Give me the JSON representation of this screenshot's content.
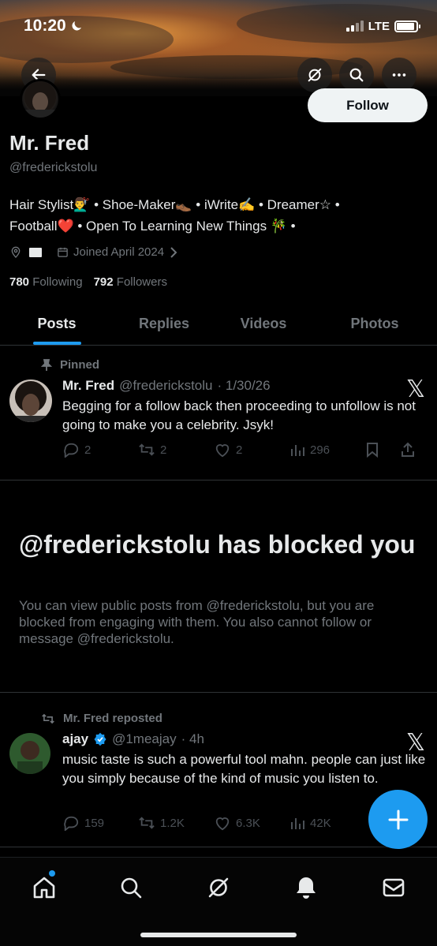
{
  "status_bar": {
    "time": "10:20",
    "network": "LTE"
  },
  "header": {
    "back_label": "Back",
    "follow_label": "Follow"
  },
  "profile": {
    "name": "Mr. Fred",
    "handle": "@frederickstolu",
    "bio_line1": "Hair Stylist💇‍♂️ • Shoe-Maker👞 • iWrite✍️ • Dreamer☆ •",
    "bio_line2": "Football❤️ • Open To Learning New Things 🎋 •",
    "joined": "Joined April 2024",
    "following_count": "780",
    "following_label": "Following",
    "followers_count": "792",
    "followers_label": "Followers"
  },
  "tabs": [
    {
      "label": "Posts",
      "active": true
    },
    {
      "label": "Replies",
      "active": false
    },
    {
      "label": "Videos",
      "active": false
    },
    {
      "label": "Photos",
      "active": false
    }
  ],
  "pinned_post": {
    "context": "Pinned",
    "name": "Mr. Fred",
    "handle": "@frederickstolu",
    "date": "· 1/30/26",
    "text": "Begging for a follow back then proceeding to unfollow is not going to make you a celebrity. Jsyk!",
    "replies": "2",
    "reposts": "2",
    "likes": "2",
    "views": "296"
  },
  "blocked": {
    "title": "@frederickstolu has blocked you",
    "body": "You can view public posts from @frederickstolu, but you are blocked from engaging with them. You also cannot follow or message @frederickstolu."
  },
  "repost": {
    "context": "Mr. Fred reposted",
    "name": "ajay",
    "handle": "@1meajay",
    "time": "· 4h",
    "text": "music taste is such a powerful tool mahn. people can just like you simply because of the kind of music you listen to.",
    "replies": "159",
    "reposts": "1.2K",
    "likes": "6.3K",
    "views": "42K"
  },
  "colors": {
    "accent": "#1d9bf0",
    "background": "#000000",
    "muted": "#71767b",
    "text": "#e7e9ea"
  },
  "icons": [
    "back-arrow-icon",
    "grok-icon",
    "search-icon",
    "more-icon",
    "location-icon",
    "flag-icon",
    "calendar-icon",
    "pin-icon",
    "repost-icon",
    "reply-icon",
    "like-icon",
    "views-icon",
    "bookmark-icon",
    "share-icon",
    "x-logo-icon",
    "verified-icon",
    "plus-icon",
    "home-icon",
    "notifications-icon",
    "messages-icon"
  ]
}
